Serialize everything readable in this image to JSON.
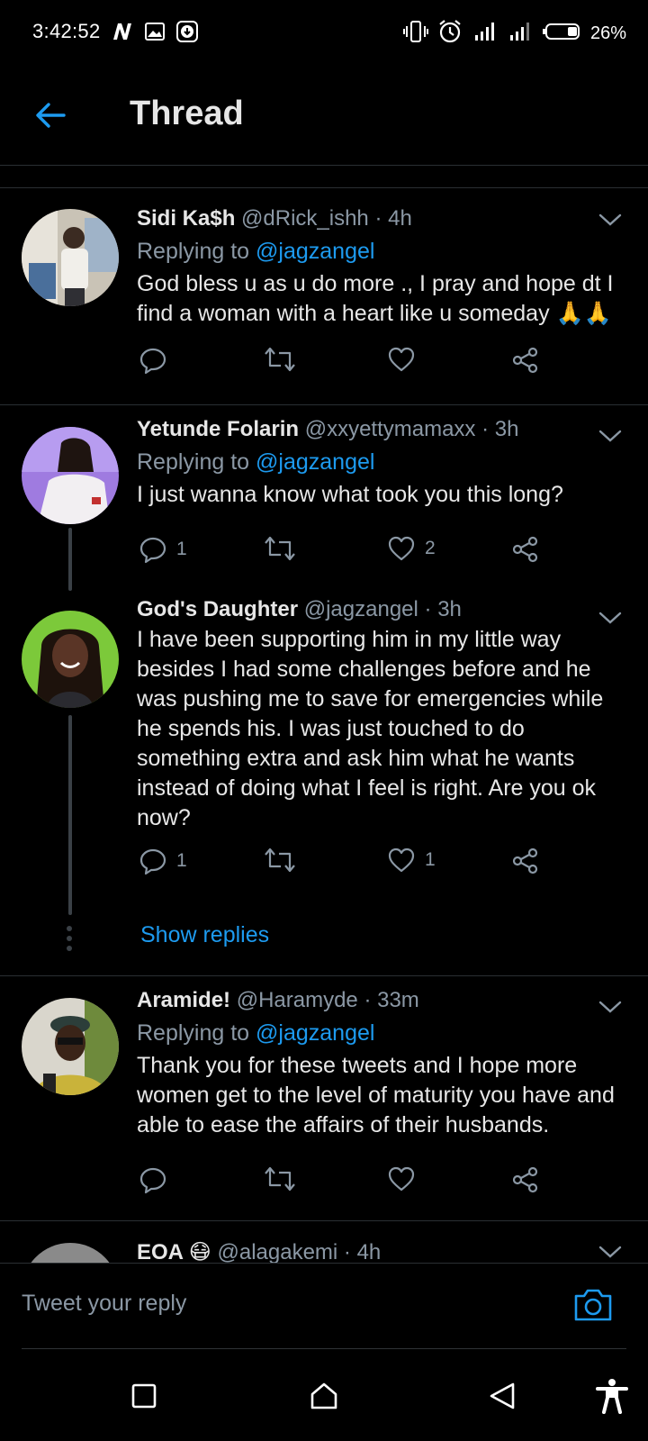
{
  "status_bar": {
    "time": "3:42:52",
    "battery": "26%",
    "icons": [
      "notification-n-icon",
      "image-icon",
      "download-icon",
      "vibrate-icon",
      "alarm-icon",
      "signal-icon",
      "signal-icon",
      "battery-icon"
    ]
  },
  "header": {
    "title": "Thread",
    "back_icon": "arrow-left-icon"
  },
  "tweets": [
    {
      "name": "Sidi Ka$h",
      "handle": "@dRick_ishh",
      "time": "· 4h",
      "replying_prefix": "Replying to",
      "replying_to": "@jagzangel",
      "text": "God bless u as u do more ., I pray and hope dt  I find a woman with a heart like u someday 🙏🙏",
      "replies": "",
      "likes": ""
    },
    {
      "name": "Yetunde Folarin",
      "handle": "@xxyettymamaxx",
      "time": "· 3h",
      "replying_prefix": "Replying to",
      "replying_to": "@jagzangel",
      "text": "I just wanna know what took you this long?",
      "replies": "1",
      "likes": "2"
    },
    {
      "name": "God's Daughter",
      "handle": "@jagzangel",
      "time": "· 3h",
      "text": "I have been supporting him in my little way besides I had some challenges before and he was pushing me to save for emergencies while he spends his. I was just touched to do something extra and ask him what he wants instead of doing what I feel is right. Are you ok now?",
      "replies": "1",
      "likes": "1",
      "show_replies": "Show replies"
    },
    {
      "name": "Aramide!",
      "handle": "@Haramyde",
      "time": "· 33m",
      "replying_prefix": "Replying to",
      "replying_to": "@jagzangel",
      "text": "Thank you for these tweets and I hope more women get to the level of maturity you have and able to ease the affairs of their husbands.",
      "replies": "",
      "likes": ""
    },
    {
      "name": "EOA 😷",
      "handle": "@alagakemi",
      "time": "· 4h"
    }
  ],
  "composer": {
    "placeholder": "Tweet your reply"
  },
  "nav": {
    "icons": [
      "recents-square-icon",
      "home-icon",
      "back-triangle-icon",
      "accessibility-icon"
    ]
  },
  "colors": {
    "accent": "#1d9bf0",
    "background": "#000000",
    "secondary_text": "#8b98a5",
    "divider": "#2a2f33"
  }
}
